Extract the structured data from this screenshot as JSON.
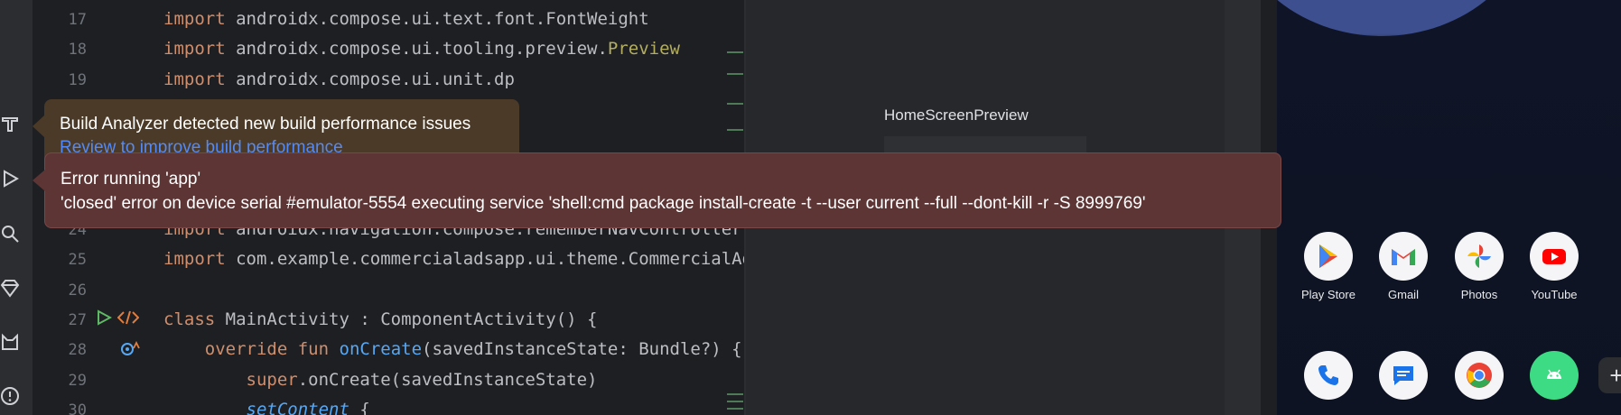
{
  "editor": {
    "lines": [
      {
        "num": "17",
        "parts": [
          {
            "t": "import",
            "c": "kw"
          },
          {
            "t": " androidx.compose.ui.text.font.FontWeight",
            "c": ""
          }
        ]
      },
      {
        "num": "18",
        "parts": [
          {
            "t": "import",
            "c": "kw"
          },
          {
            "t": " androidx.compose.ui.tooling.preview.",
            "c": ""
          },
          {
            "t": "Preview",
            "c": "yl"
          }
        ]
      },
      {
        "num": "19",
        "parts": [
          {
            "t": "import",
            "c": "kw"
          },
          {
            "t": " androidx.compose.ui.unit.dp",
            "c": ""
          }
        ]
      },
      {
        "num": "",
        "parts": [
          {
            "t": "                          p",
            "c": ""
          }
        ]
      },
      {
        "num": "",
        "parts": [
          {
            "t": "                          troller",
            "c": ""
          }
        ]
      },
      {
        "num": "",
        "parts": []
      },
      {
        "num": "",
        "parts": []
      },
      {
        "num": "24",
        "parts": [
          {
            "t": "import",
            "c": "kw"
          },
          {
            "t": " androidx.navigation.compose.rememberNavController",
            "c": ""
          }
        ]
      },
      {
        "num": "25",
        "parts": [
          {
            "t": "import",
            "c": "kw"
          },
          {
            "t": " com.example.commercialadsapp.ui.theme.CommercialAdsAppTheme",
            "c": ""
          }
        ]
      },
      {
        "num": "26",
        "parts": []
      },
      {
        "num": "27",
        "parts": [
          {
            "t": "class",
            "c": "kw"
          },
          {
            "t": " MainActivity : ComponentActivity() {",
            "c": ""
          }
        ]
      },
      {
        "num": "28",
        "parts": [
          {
            "t": "    ",
            "c": ""
          },
          {
            "t": "override fun",
            "c": "kw"
          },
          {
            "t": " ",
            "c": ""
          },
          {
            "t": "onCreate",
            "c": "fn"
          },
          {
            "t": "(savedInstanceState: Bundle?) {",
            "c": ""
          }
        ]
      },
      {
        "num": "29",
        "parts": [
          {
            "t": "        ",
            "c": ""
          },
          {
            "t": "super",
            "c": "kw"
          },
          {
            "t": ".onCreate(savedInstanceState)",
            "c": ""
          }
        ]
      },
      {
        "num": "30",
        "parts": [
          {
            "t": "        ",
            "c": ""
          },
          {
            "t": "setContent",
            "c": "fn it"
          },
          {
            "t": " {",
            "c": ""
          }
        ]
      }
    ]
  },
  "preview": {
    "title": "HomeScreenPreview"
  },
  "notifications": {
    "build_analyzer": {
      "message": "Build Analyzer detected new build performance issues",
      "link": "Review to improve build performance"
    },
    "run_error": {
      "title": "Error running 'app'",
      "message": "'closed' error on device serial #emulator-5554 executing service 'shell:cmd package install-create -t --user current --full --dont-kill -r -S 8999769'"
    }
  },
  "emulator": {
    "apps_row1": [
      {
        "label": "Play Store",
        "icon": "play-store-icon"
      },
      {
        "label": "Gmail",
        "icon": "gmail-icon"
      },
      {
        "label": "Photos",
        "icon": "photos-icon"
      },
      {
        "label": "YouTube",
        "icon": "youtube-icon"
      }
    ],
    "apps_row2": [
      {
        "label": "",
        "icon": "phone-icon"
      },
      {
        "label": "",
        "icon": "messages-icon"
      },
      {
        "label": "",
        "icon": "chrome-icon"
      },
      {
        "label": "",
        "icon": "android-icon"
      }
    ],
    "fab_symbol": "+"
  },
  "colors": {
    "keyword": "#cf8e6d",
    "function": "#56a8f5",
    "error_balloon": "#5d3535",
    "warning_balloon": "#4a3a27"
  }
}
